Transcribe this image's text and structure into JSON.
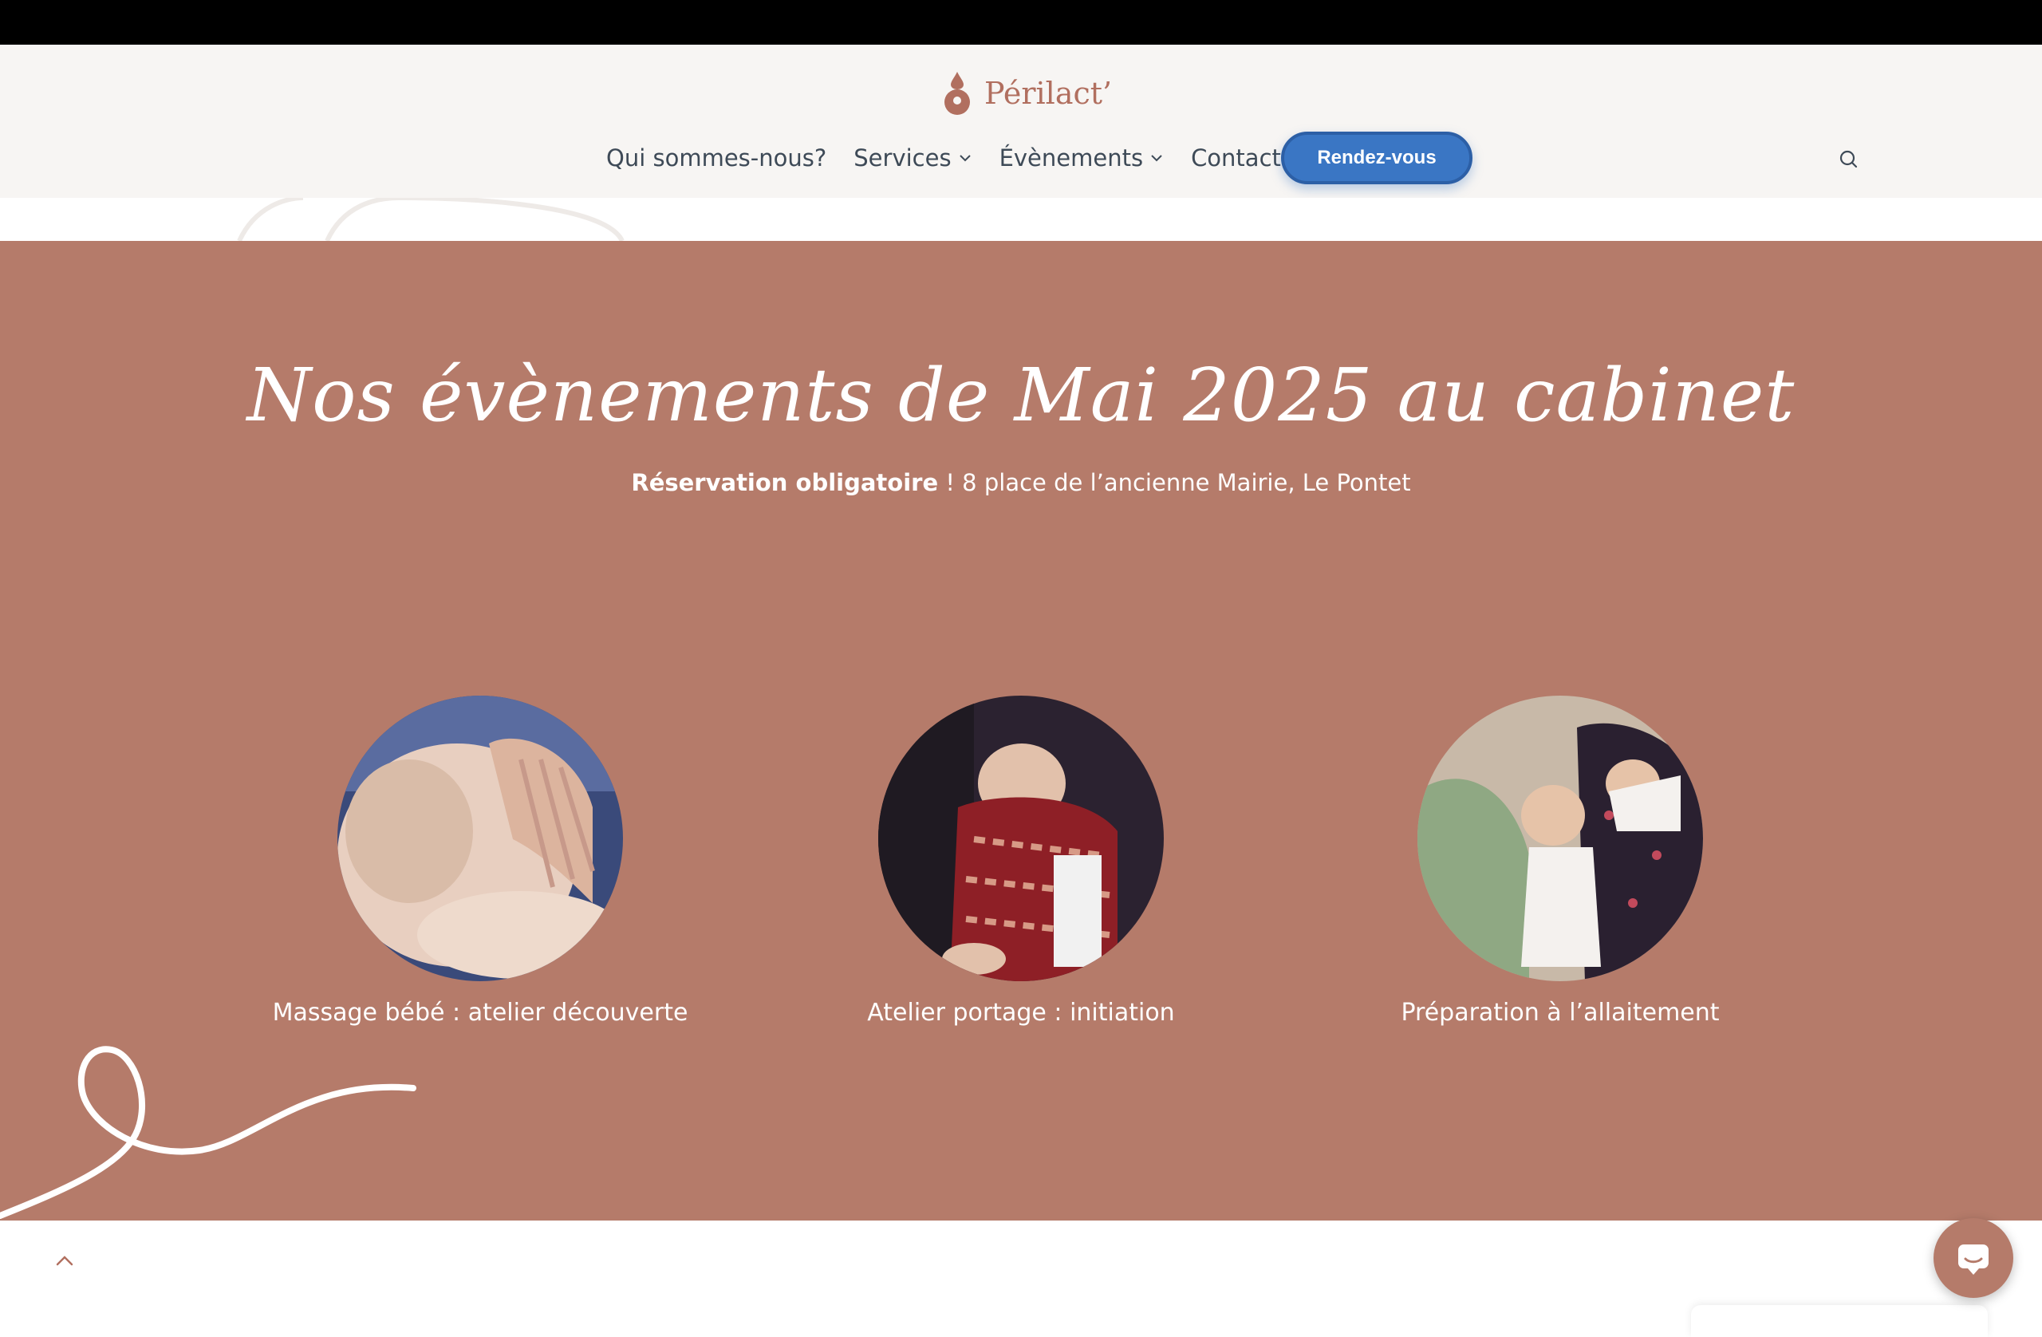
{
  "header": {
    "brand": "Périlact’",
    "nav": [
      {
        "label": "Qui sommes-nous?",
        "has_dropdown": false
      },
      {
        "label": "Services",
        "has_dropdown": true
      },
      {
        "label": "Évènements",
        "has_dropdown": true
      },
      {
        "label": "Contact",
        "has_dropdown": false
      }
    ],
    "cta_label": "Rendez-vous",
    "search_icon": "search-icon"
  },
  "events": {
    "title": "Nos évènements de Mai 2025 au cabinet",
    "subtitle_bold": "Réservation obligatoire",
    "subtitle_rest": " ! 8 place de l’ancienne Mairie, Le Pontet",
    "cards": [
      {
        "label": "Massage bébé : atelier découverte"
      },
      {
        "label": "Atelier portage : initiation"
      },
      {
        "label": "Préparation à l’allaitement"
      }
    ]
  },
  "colors": {
    "section_bg": "#b57b6a",
    "brand": "#b16f5f",
    "cta": "#3a76c4",
    "header_bg": "#f7f5f3"
  },
  "icons": [
    "logo-drop-icon",
    "chevron-down-icon",
    "search-icon",
    "scroll-top-icon",
    "chat-icon"
  ]
}
